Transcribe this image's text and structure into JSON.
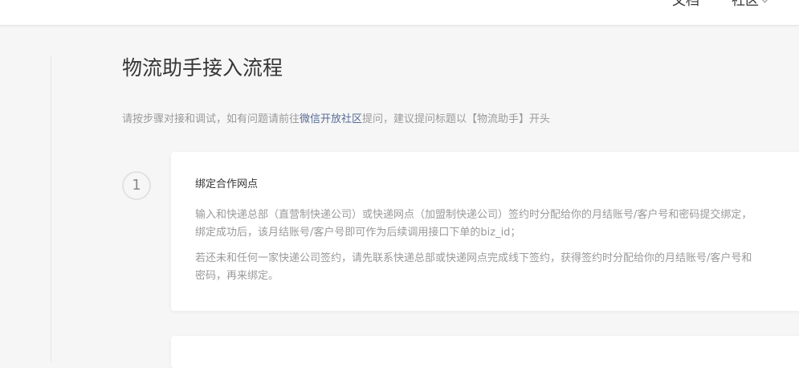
{
  "header": {
    "nav_docs": "文档",
    "nav_community": "社区"
  },
  "main": {
    "title": "物流助手接入流程",
    "intro_before": "请按步骤对接和调试，如有问题请前往",
    "intro_link": "微信开放社区",
    "intro_after": "提问，建议提问标题以【物流助手】开头",
    "steps": [
      {
        "number": "1",
        "title": "绑定合作网点",
        "paragraphs": [
          "输入和快递总部（直营制快递公司）或快递网点（加盟制快递公司）签约时分配给你的月结账号/客户号和密码提交绑定， 绑定成功后，该月结账号/客户号即可作为后续调用接口下单的biz_id；",
          "若还未和任何一家快递公司签约，请先联系快递总部或快递网点完成线下签约，获得签约时分配给你的月结账号/客户号和密码，再来绑定。"
        ]
      }
    ]
  },
  "colors": {
    "link": "#576b95",
    "text_primary": "#353535",
    "text_secondary": "#9a9a9a",
    "background": "#f6f6f6"
  },
  "icons": {
    "community_dropdown": "chevron-down-icon"
  }
}
